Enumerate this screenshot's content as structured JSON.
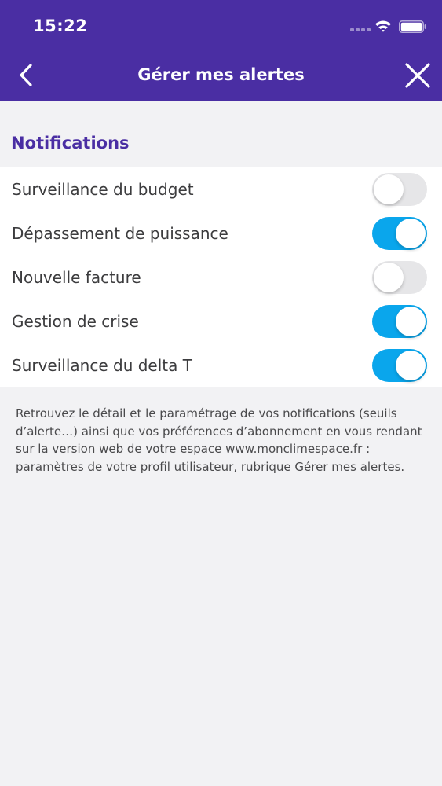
{
  "status_bar": {
    "time": "15:22"
  },
  "nav": {
    "title": "Gérer mes alertes",
    "back_icon": "chevron-left-icon",
    "close_icon": "close-icon"
  },
  "colors": {
    "header_bg": "#4a2ea3",
    "section_title": "#4a2ea3",
    "toggle_on": "#0aa6ec",
    "toggle_off": "#e6e6e8",
    "page_bg": "#f2f2f4"
  },
  "notifications": {
    "title": "Notifications",
    "items": [
      {
        "label": "Surveillance du budget",
        "enabled": false
      },
      {
        "label": "Dépassement de puissance",
        "enabled": true
      },
      {
        "label": "Nouvelle facture",
        "enabled": false
      },
      {
        "label": "Gestion de crise",
        "enabled": true
      },
      {
        "label": "Surveillance du delta T",
        "enabled": true
      }
    ]
  },
  "footnote": "Retrouvez le détail et le paramétrage de vos notifications (seuils d’alerte…) ainsi que vos préférences d’abonnement en vous rendant sur la version web de votre espace www.monclimespace.fr : paramètres de votre profil utilisateur, rubrique Gérer mes alertes."
}
